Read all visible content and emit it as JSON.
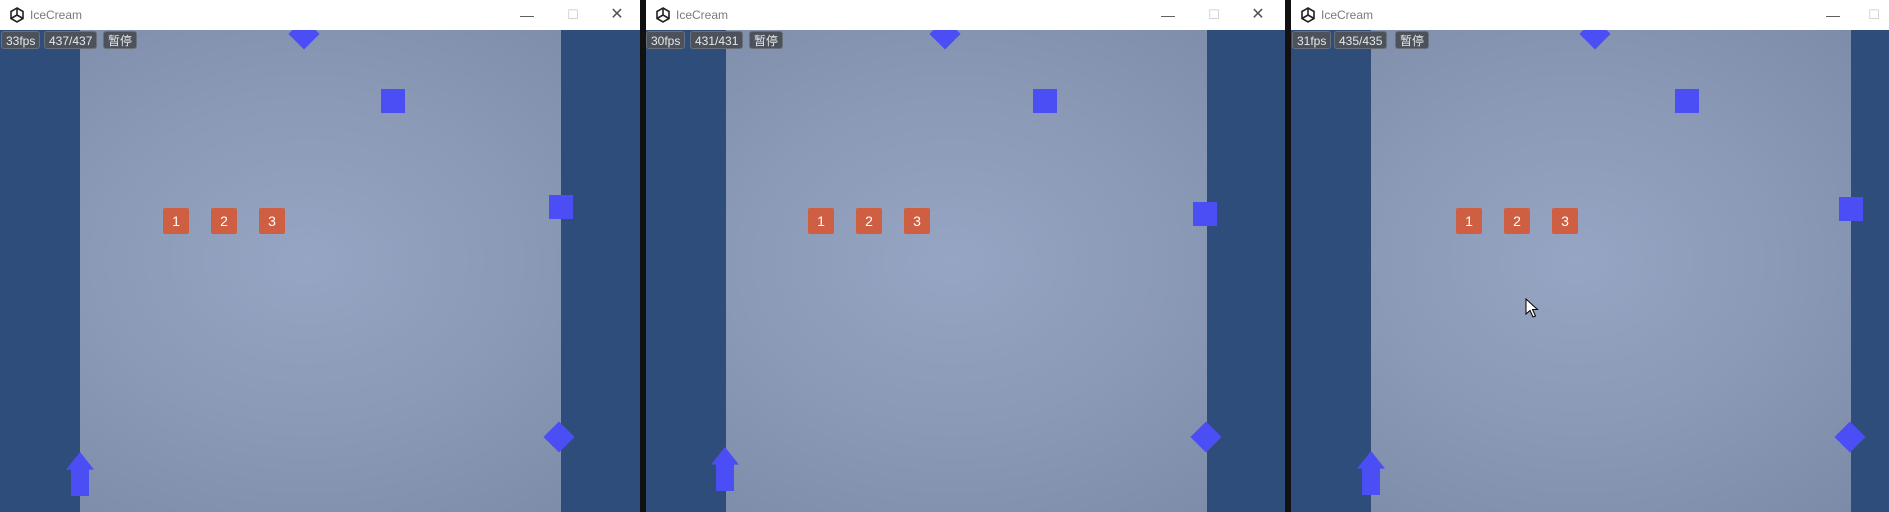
{
  "app_title": "IceCream",
  "pause_label": "暂停",
  "windows": [
    {
      "fps": "33fps",
      "count": "437/437",
      "tiles": [
        "1",
        "2",
        "3"
      ]
    },
    {
      "fps": "30fps",
      "count": "431/431",
      "tiles": [
        "1",
        "2",
        "3"
      ]
    },
    {
      "fps": "31fps",
      "count": "435/435",
      "tiles": [
        "1",
        "2",
        "3"
      ]
    }
  ],
  "colors": {
    "side_band": "#2e4d7a",
    "shape_blue": "#4a4ef4",
    "tile_orange": "#cf5f43",
    "hud_bg": "#4c525b"
  },
  "icons": {
    "app_logo": "unity-logo-icon",
    "minimize": "minimize-icon",
    "maximize": "maximize-icon",
    "close": "close-icon",
    "cursor": "mouse-pointer-icon"
  }
}
